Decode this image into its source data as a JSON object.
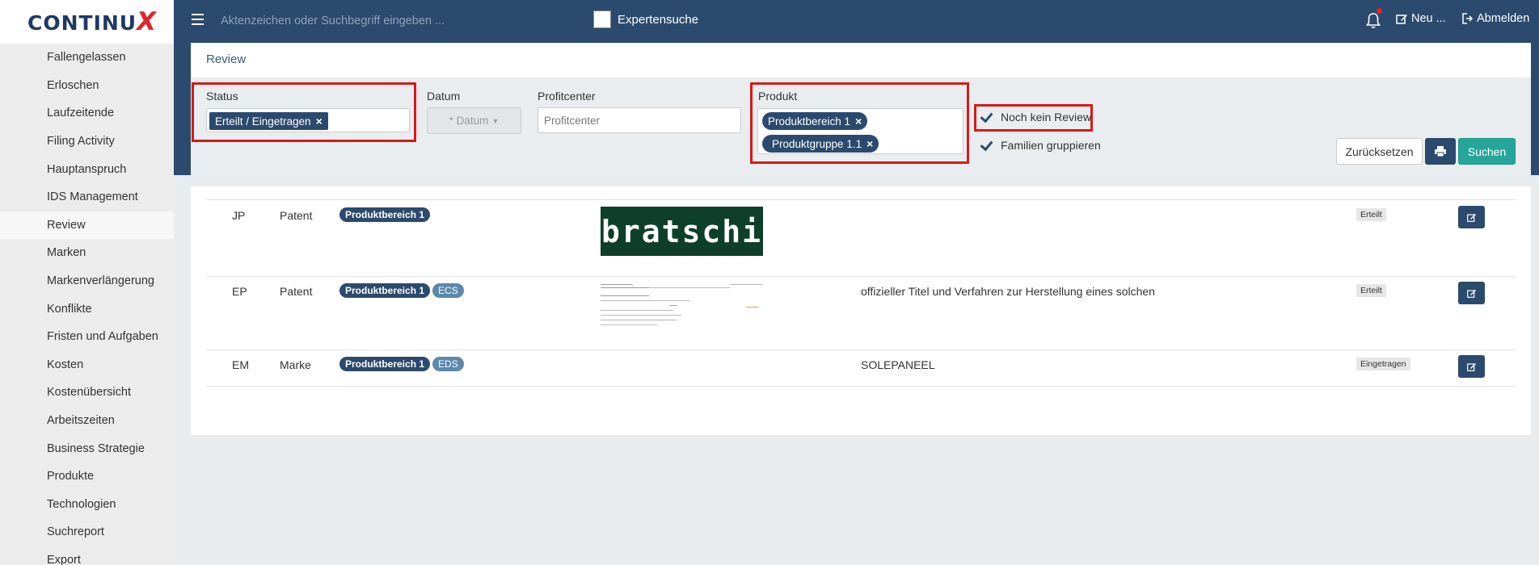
{
  "app": {
    "logo_main": "CONTINU",
    "logo_x": "X"
  },
  "sidebar": {
    "items": [
      {
        "label": "Fallengelassen"
      },
      {
        "label": "Erloschen"
      },
      {
        "label": "Laufzeitende"
      },
      {
        "label": "Filing Activity"
      },
      {
        "label": "Hauptanspruch"
      },
      {
        "label": "IDS Management"
      },
      {
        "label": "Review",
        "active": true
      },
      {
        "label": "Marken"
      },
      {
        "label": "Markenverlängerung"
      },
      {
        "label": "Konflikte"
      },
      {
        "label": "Fristen und Aufgaben"
      },
      {
        "label": "Kosten"
      },
      {
        "label": "Kostenübersicht"
      },
      {
        "label": "Arbeitszeiten"
      },
      {
        "label": "Business Strategie"
      },
      {
        "label": "Produkte"
      },
      {
        "label": "Technologien"
      },
      {
        "label": "Suchreport"
      },
      {
        "label": "Export"
      }
    ]
  },
  "topbar": {
    "search_placeholder": "Aktenzeichen oder Suchbegriff eingeben ...",
    "expert_label": "Expertensuche",
    "new_label": "Neu ...",
    "logout_label": "Abmelden",
    "notification_dot_color": "#e0232b"
  },
  "page": {
    "title": "Review"
  },
  "filters": {
    "status": {
      "label": "Status",
      "tags": [
        "Erteilt / Eingetragen"
      ]
    },
    "datum": {
      "label": "Datum",
      "button": "* Datum"
    },
    "profitcenter": {
      "label": "Profitcenter",
      "placeholder": "Profitcenter"
    },
    "produkt": {
      "label": "Produkt",
      "tags": [
        "Produktbereich 1",
        "Produktgruppe 1.1"
      ]
    },
    "no_review": {
      "label": "Noch kein Review",
      "checked": true
    },
    "group_families": {
      "label": "Familien gruppieren",
      "checked": true
    },
    "reset_label": "Zurücksetzen",
    "search_label": "Suchen"
  },
  "results": [
    {
      "country": "JP",
      "type": "Patent",
      "tags": [
        "Produktbereich 1"
      ],
      "image": "bratschi",
      "image_text": "bratschi",
      "title": "",
      "status": "Erteilt"
    },
    {
      "country": "EP",
      "type": "Patent",
      "tags": [
        "Produktbereich 1",
        "ECS"
      ],
      "image": "document",
      "title": "offizieller Titel und Verfahren zur Herstellung eines solchen",
      "status": "Erteilt"
    },
    {
      "country": "EM",
      "type": "Marke",
      "tags": [
        "Produktbereich 1",
        "EDS"
      ],
      "image": "",
      "title": "SOLEPANEEL",
      "status": "Eingetragen"
    }
  ],
  "colors": {
    "navy": "#2c4a6d",
    "teal": "#26a69a",
    "highlight_red": "#d61a1a",
    "logo_red": "#e0232b",
    "bratschi_green": "#0e3f2b"
  }
}
